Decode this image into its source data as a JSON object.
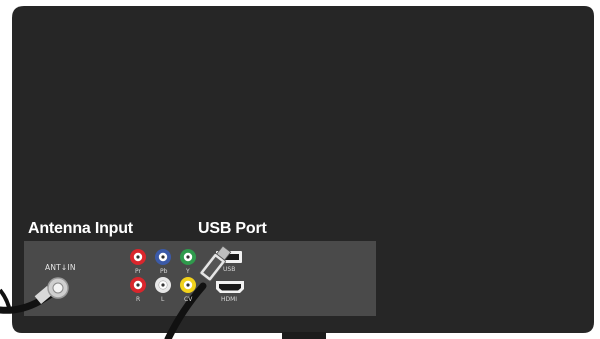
{
  "labels": {
    "antenna_input": "Antenna Input",
    "usb_port": "USB Port",
    "ant_in": "ANT↓IN"
  },
  "jacks": {
    "pr": "Pr",
    "pb": "Pb",
    "y": "Y",
    "r": "R",
    "l": "L",
    "cvbs": "CV",
    "usb": "USB",
    "hdmi": "HDMI"
  },
  "colors": {
    "tv_body": "#262626",
    "panel": "#4a4a4a",
    "red": "#d9262c",
    "blue": "#3b5aa8",
    "green": "#2f9a4c",
    "yellow": "#f2d21b",
    "white_jack": "#e8e8e8"
  }
}
